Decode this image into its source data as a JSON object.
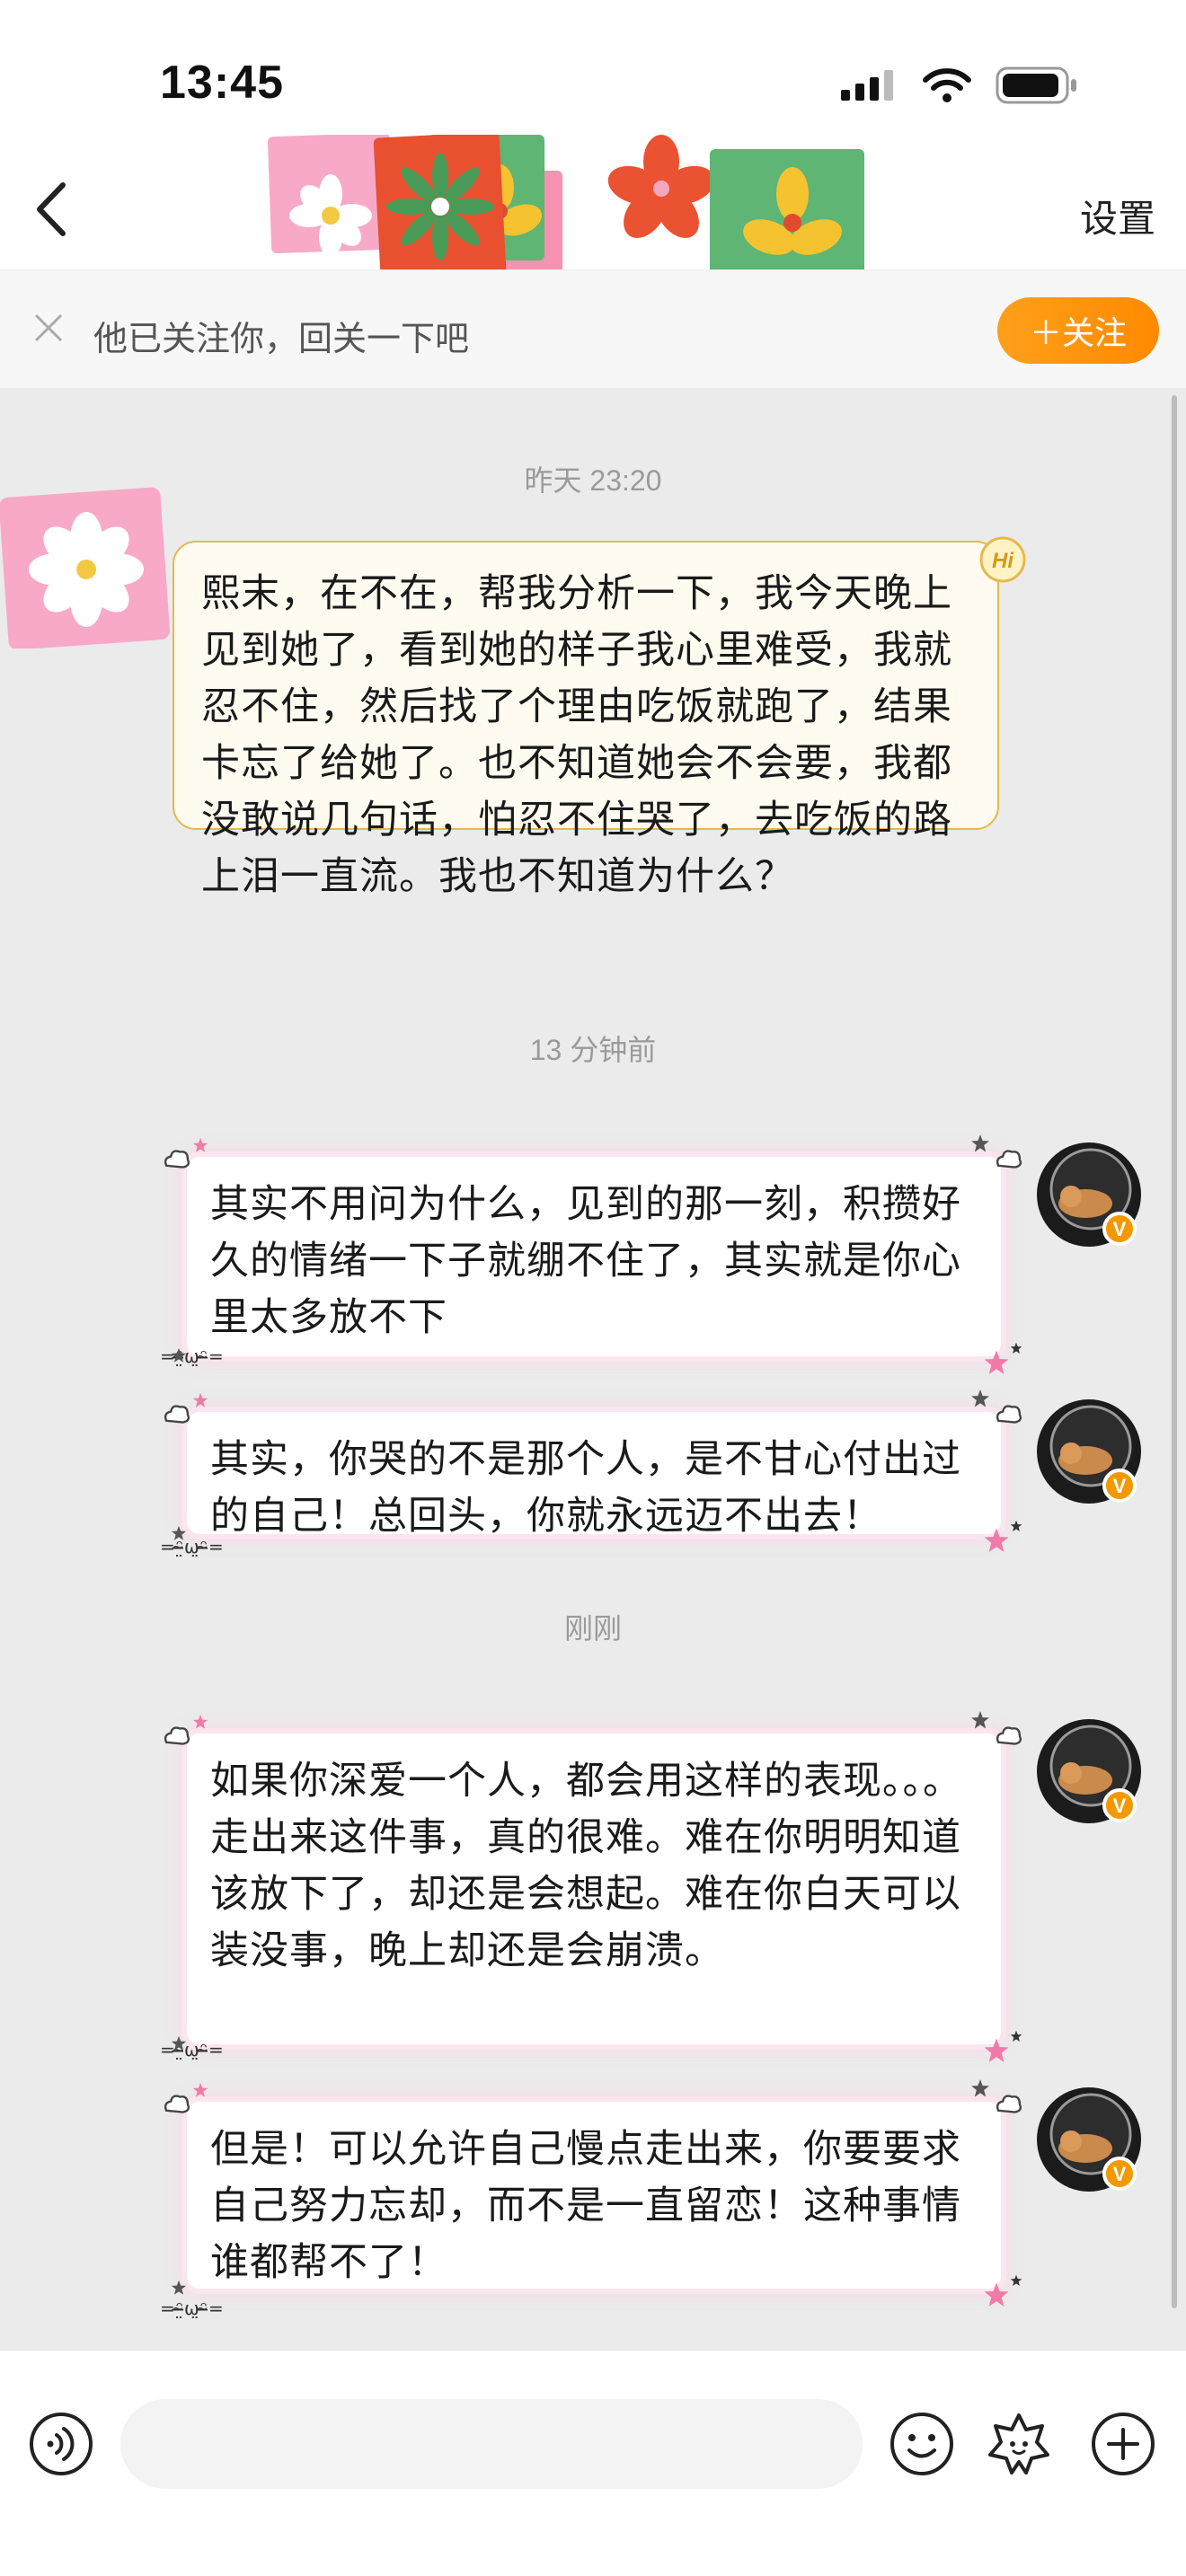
{
  "status_bar": {
    "time": "13:45"
  },
  "header": {
    "settings_label": "设置"
  },
  "follow_banner": {
    "text": "他已关注你，回关一下吧",
    "button_label": "＋关注"
  },
  "chat": {
    "timestamps": [
      "昨天 23:20",
      "13 分钟前",
      "刚刚"
    ],
    "incoming": [
      {
        "text": "熙末，在不在，帮我分析一下，我今天晚上见到她了，看到她的样子我心里难受，我就忍不住，然后找了个理由吃饭就跑了，结果卡忘了给她了。也不知道她会不会要，我都没敢说几句话，怕忍不住哭了，去吃饭的路上泪一直流。我也不知道为什么？",
        "badge": "Hi"
      }
    ],
    "outgoing": [
      {
        "text": "其实不用问为什么，见到的那一刻，积攒好久的情绪一下子就绷不住了，其实就是你心里太多放不下"
      },
      {
        "text": "其实，你哭的不是那个人，是不甘心付出过的自己！总回头，你就永远迈不出去！"
      },
      {
        "text": "如果你深爱一个人，都会用这样的表现。。。\n走出来这件事，真的很难。难在你明明知道该放下了，却还是会想起。难在你白天可以装没事，晚上却还是会崩溃。"
      },
      {
        "text": "但是！可以允许自己慢点走出来，你要要求自己努力忘却，而不是一直留恋！这种事情谁都帮不了！"
      }
    ],
    "kaomoji": "=ᵔ̴̶̤ω̤ᵔ̴̶=",
    "verified_badge": "V"
  },
  "input_bar": {
    "placeholder": ""
  },
  "colors": {
    "accent": "#ff8a00",
    "bubble_border": "#e8b84a",
    "glow": "#fbe6ef"
  },
  "icons": [
    "back-icon",
    "close-icon",
    "voice-icon",
    "emoji-icon",
    "sticker-icon",
    "plus-icon",
    "signal-icon",
    "wifi-icon",
    "battery-icon"
  ]
}
